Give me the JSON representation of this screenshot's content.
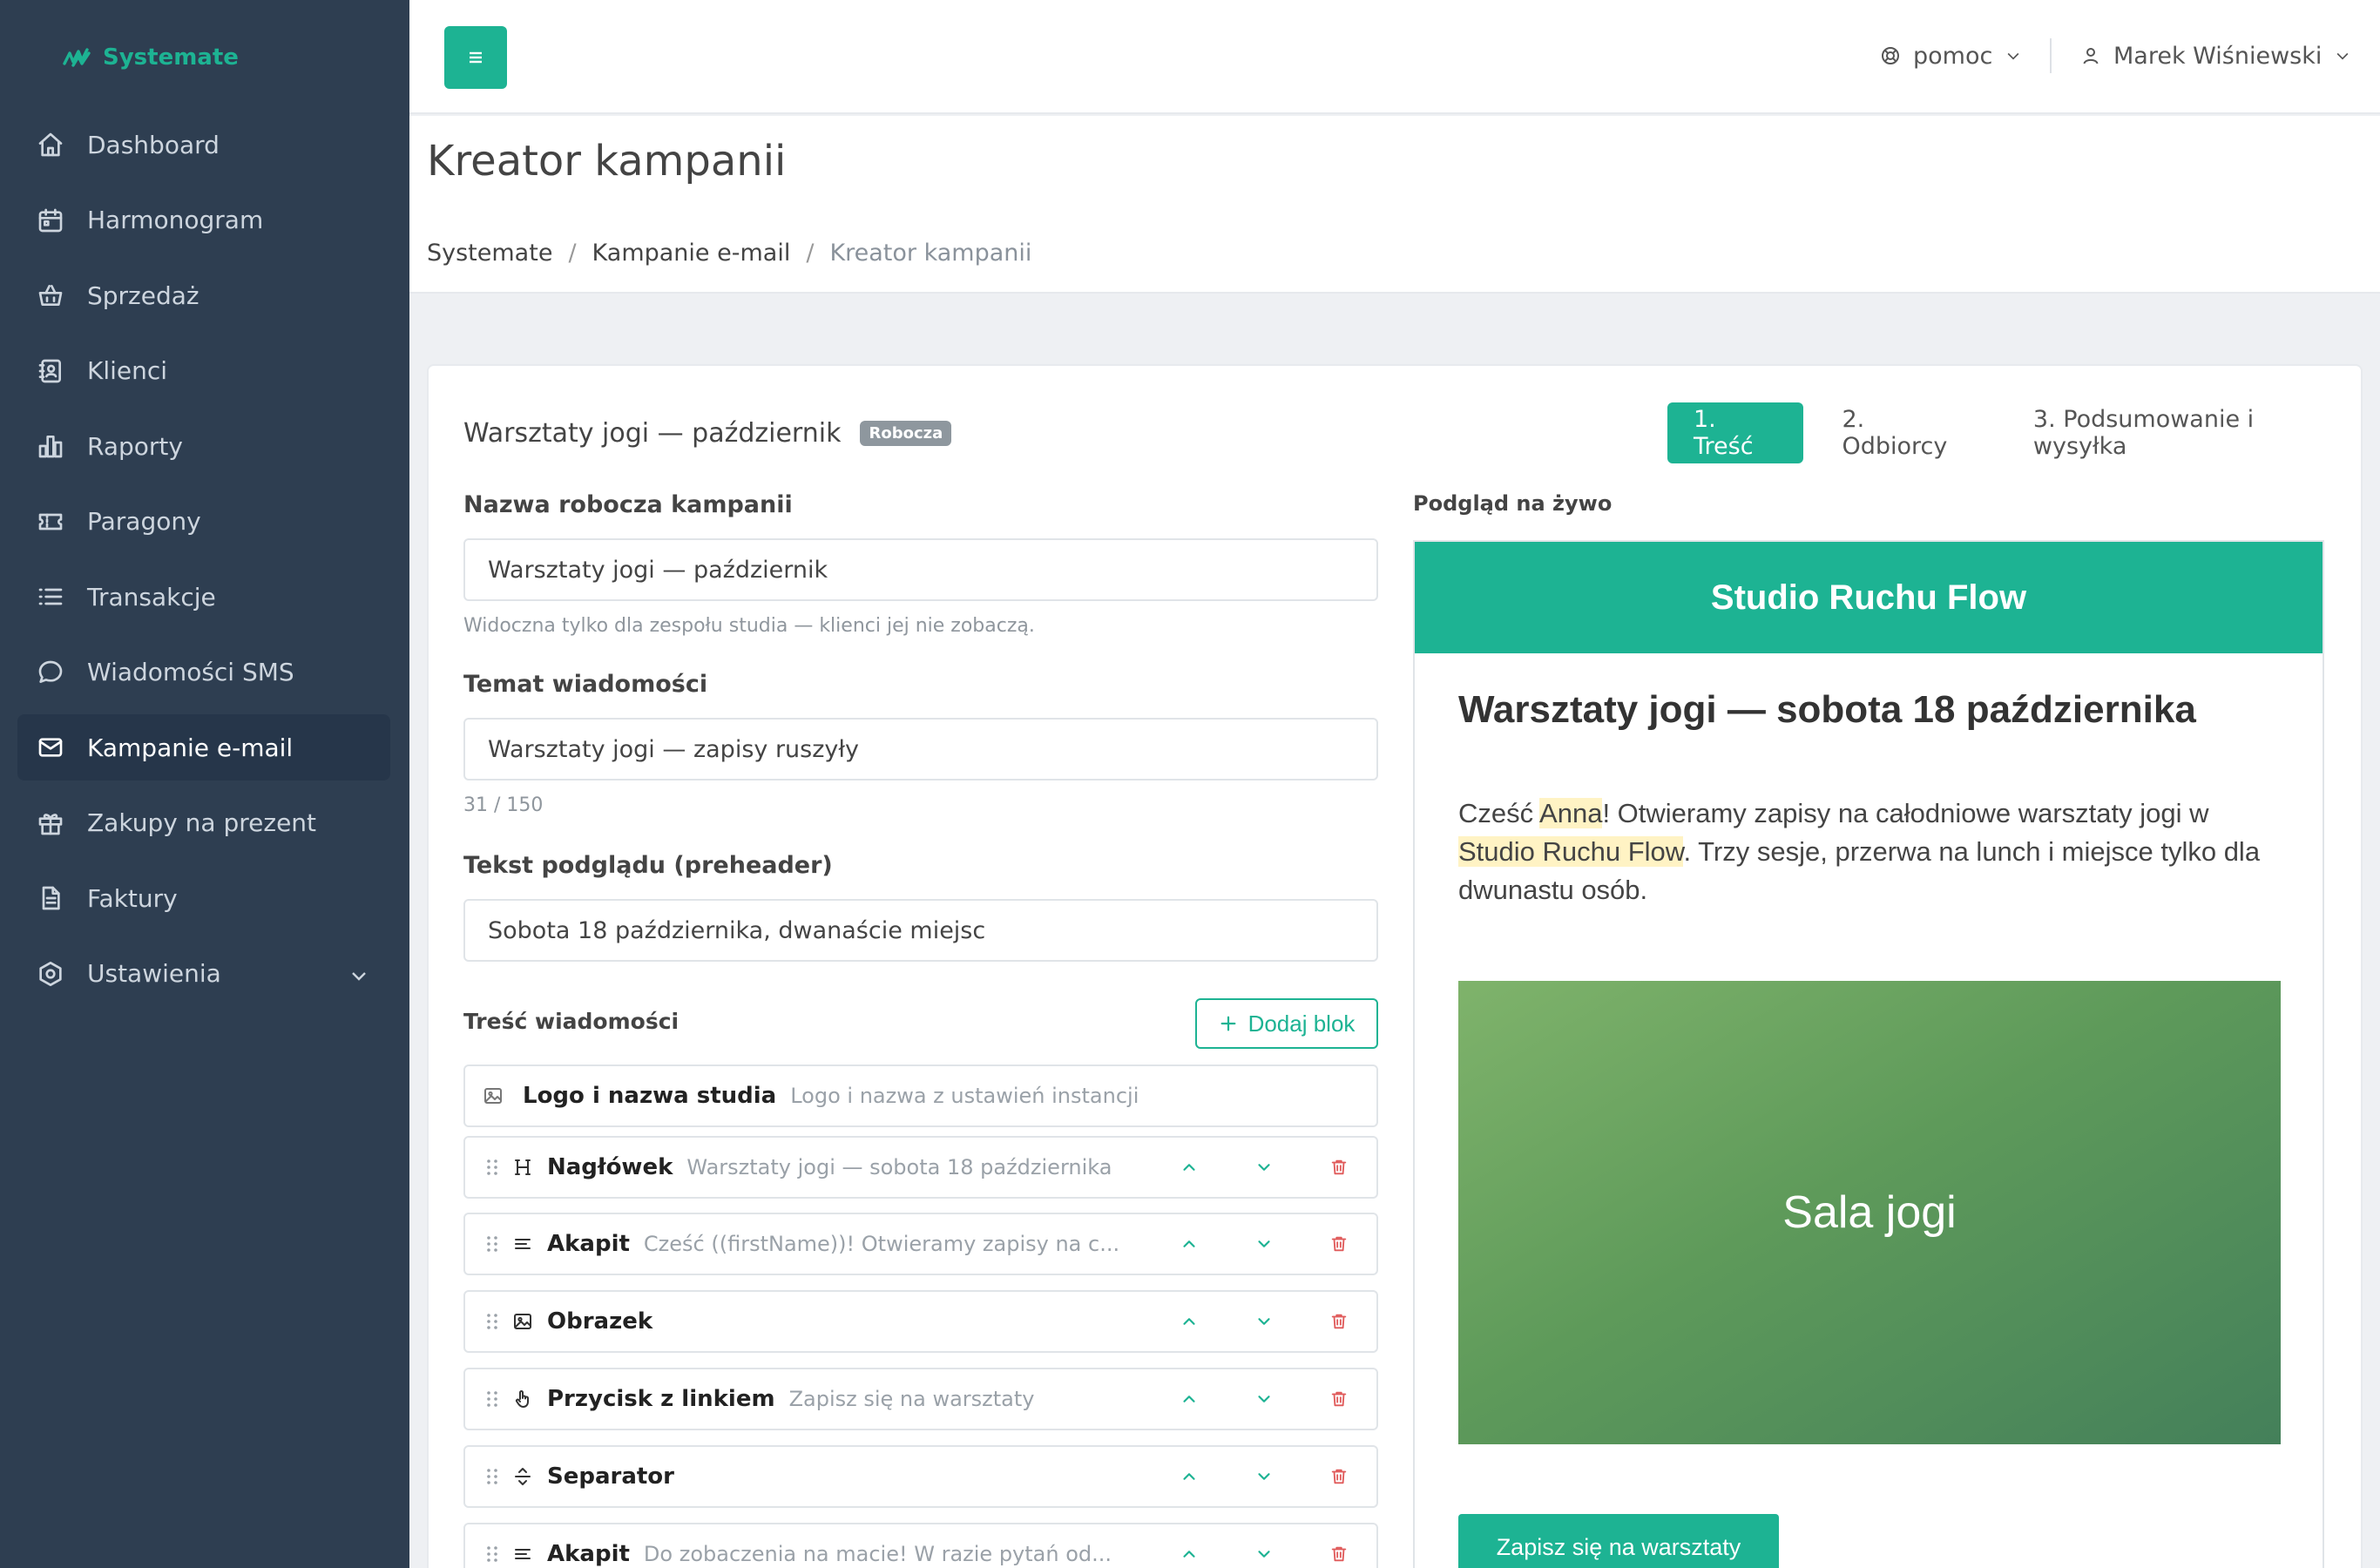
{
  "app": {
    "brand": "Systemate"
  },
  "sidebar": {
    "items": [
      {
        "label": "Dashboard",
        "icon": "home-icon"
      },
      {
        "label": "Harmonogram",
        "icon": "calendar-icon"
      },
      {
        "label": "Sprzedaż",
        "icon": "basket-icon"
      },
      {
        "label": "Klienci",
        "icon": "contacts-icon"
      },
      {
        "label": "Raporty",
        "icon": "bar-chart-icon"
      },
      {
        "label": "Paragony",
        "icon": "ticket-icon"
      },
      {
        "label": "Transakcje",
        "icon": "list-icon"
      },
      {
        "label": "Wiadomości SMS",
        "icon": "chat-icon"
      },
      {
        "label": "Kampanie e-mail",
        "icon": "mail-icon",
        "active": true
      },
      {
        "label": "Zakupy na prezent",
        "icon": "gift-icon"
      },
      {
        "label": "Faktury",
        "icon": "document-icon"
      },
      {
        "label": "Ustawienia",
        "icon": "settings-icon"
      }
    ]
  },
  "topbar": {
    "help_label": "pomoc",
    "user_name": "Marek Wiśniewski"
  },
  "page": {
    "title": "Kreator kampanii",
    "breadcrumbs": [
      "Systemate",
      "Kampanie e-mail",
      "Kreator kampanii"
    ]
  },
  "campaign": {
    "title": "Warsztaty jogi — październik",
    "status_badge": "Robocza"
  },
  "steps": [
    "1. Treść",
    "2. Odbiorcy",
    "3. Podsumowanie i wysyłka"
  ],
  "form": {
    "name_label": "Nazwa robocza kampanii",
    "name_value": "Warsztaty jogi — październik",
    "name_help": "Widoczna tylko dla zespołu studia — klienci jej nie zobaczą.",
    "subject_label": "Temat wiadomości",
    "subject_value": "Warsztaty jogi — zapisy ruszyły",
    "subject_counter": "31 / 150",
    "preheader_label": "Tekst podglądu (preheader)",
    "preheader_value": "Sobota 18 października, dwanaście miejsc",
    "content_label": "Treść wiadomości",
    "add_block_label": "Dodaj blok"
  },
  "blocks": [
    {
      "name": "Logo i nazwa studia",
      "desc": "Logo i nazwa z ustawień instancji",
      "icon": "image-icon"
    },
    {
      "name": "Nagłówek",
      "desc": "Warsztaty jogi — sobota 18 października",
      "icon": "heading-icon"
    },
    {
      "name": "Akapit",
      "desc": "Cześć ((firstName))! Otwieramy zapisy na c...",
      "icon": "paragraph-icon"
    },
    {
      "name": "Obrazek",
      "desc": "",
      "icon": "picture-icon"
    },
    {
      "name": "Przycisk z linkiem",
      "desc": "Zapisz się na warsztaty",
      "icon": "pointer-hand-icon"
    },
    {
      "name": "Separator",
      "desc": "",
      "icon": "separator-icon"
    },
    {
      "name": "Akapit",
      "desc": "Do zobaczenia na macie! W razie pytań od...",
      "icon": "paragraph-icon"
    }
  ],
  "preview": {
    "label": "Podgląd na żywo",
    "header": "Studio Ruchu Flow",
    "title": "Warsztaty jogi — sobota 18 października",
    "para_1": "Cześć ",
    "para_name": "Anna",
    "para_2": "! Otwieramy zapisy na całodniowe warsztaty jogi w ",
    "para_studio": "Studio Ruchu Flow",
    "para_3": ". Trzy sesje, przerwa na lunch i miejsce tylko dla dwunastu osób.",
    "image_label": "Sala jogi",
    "button_label": "Zapisz się na warsztaty"
  },
  "colors": {
    "accent": "#1db393",
    "sidebar_bg": "#2e3e51",
    "danger": "#e05a5a",
    "highlight": "#fff3c4"
  }
}
